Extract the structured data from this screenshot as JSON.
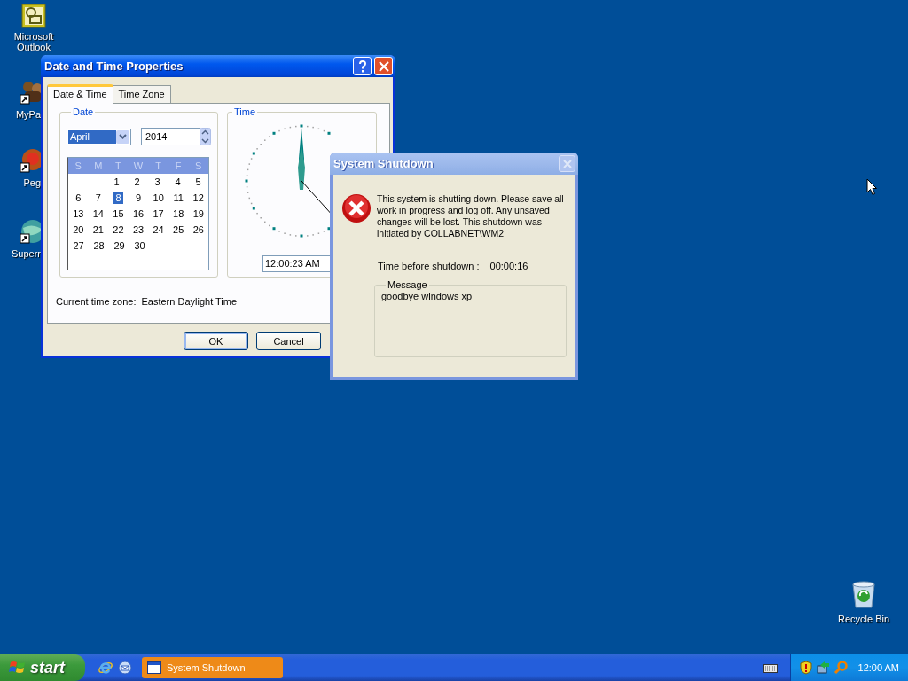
{
  "desktop_icons": [
    {
      "label": "Microsoft Outlook"
    },
    {
      "label": "MyPa"
    },
    {
      "label": "Peg"
    },
    {
      "label": "Superr"
    }
  ],
  "recycle_bin": {
    "label": "Recycle Bin"
  },
  "date_time_window": {
    "title": "Date and Time Properties",
    "active": true,
    "tabs": [
      {
        "label": "Date & Time",
        "selected": true
      },
      {
        "label": "Time Zone",
        "selected": false
      }
    ],
    "date_group": {
      "label": "Date",
      "month": "April",
      "year": "2014",
      "weekdays": [
        "S",
        "M",
        "T",
        "W",
        "T",
        "F",
        "S"
      ],
      "weeks": [
        {
          "starts_mid_week": true,
          "days": [
            {
              "label": "1",
              "selected": false
            },
            {
              "label": "2",
              "selected": false
            },
            {
              "label": "3",
              "selected": false
            },
            {
              "label": "4",
              "selected": false
            },
            {
              "label": "5",
              "selected": false
            }
          ]
        },
        {
          "starts_mid_week": false,
          "days": [
            {
              "label": "6",
              "selected": false
            },
            {
              "label": "7",
              "selected": false
            },
            {
              "label": "8",
              "selected": true
            },
            {
              "label": "9",
              "selected": false
            },
            {
              "label": "10",
              "selected": false
            },
            {
              "label": "11",
              "selected": false
            },
            {
              "label": "12",
              "selected": false
            }
          ]
        },
        {
          "starts_mid_week": false,
          "days": [
            {
              "label": "13",
              "selected": false
            },
            {
              "label": "14",
              "selected": false
            },
            {
              "label": "15",
              "selected": false
            },
            {
              "label": "16",
              "selected": false
            },
            {
              "label": "17",
              "selected": false
            },
            {
              "label": "18",
              "selected": false
            },
            {
              "label": "19",
              "selected": false
            }
          ]
        },
        {
          "starts_mid_week": false,
          "days": [
            {
              "label": "20",
              "selected": false
            },
            {
              "label": "21",
              "selected": false
            },
            {
              "label": "22",
              "selected": false
            },
            {
              "label": "23",
              "selected": false
            },
            {
              "label": "24",
              "selected": false
            },
            {
              "label": "25",
              "selected": false
            },
            {
              "label": "26",
              "selected": false
            }
          ]
        },
        {
          "starts_mid_week": false,
          "days": [
            {
              "label": "27",
              "selected": false
            },
            {
              "label": "28",
              "selected": false
            },
            {
              "label": "29",
              "selected": false
            },
            {
              "label": "30",
              "selected": false
            }
          ]
        }
      ]
    },
    "time_group": {
      "label": "Time",
      "time": "12:00:23 AM"
    },
    "time_zone": {
      "label": "Current time zone:",
      "value": "Eastern Daylight Time"
    },
    "buttons": [
      {
        "label": "OK",
        "default": true
      },
      {
        "label": "Cancel",
        "default": false
      }
    ]
  },
  "shutdown_dialog": {
    "title": "System Shutdown",
    "active": false,
    "message": "This system is shutting down. Please save all work in progress and log off. Any unsaved changes will be lost. This shutdown was initiated by COLLABNET\\WM2",
    "countdown_label": "Time before shutdown :",
    "countdown": "00:00:16",
    "message_group": {
      "label": "Message",
      "text": "goodbye windows xp"
    }
  },
  "taskbar": {
    "start": "start",
    "tasks": [
      {
        "label": "System Shutdown",
        "selected": true
      }
    ],
    "clock": "12:00 AM"
  }
}
